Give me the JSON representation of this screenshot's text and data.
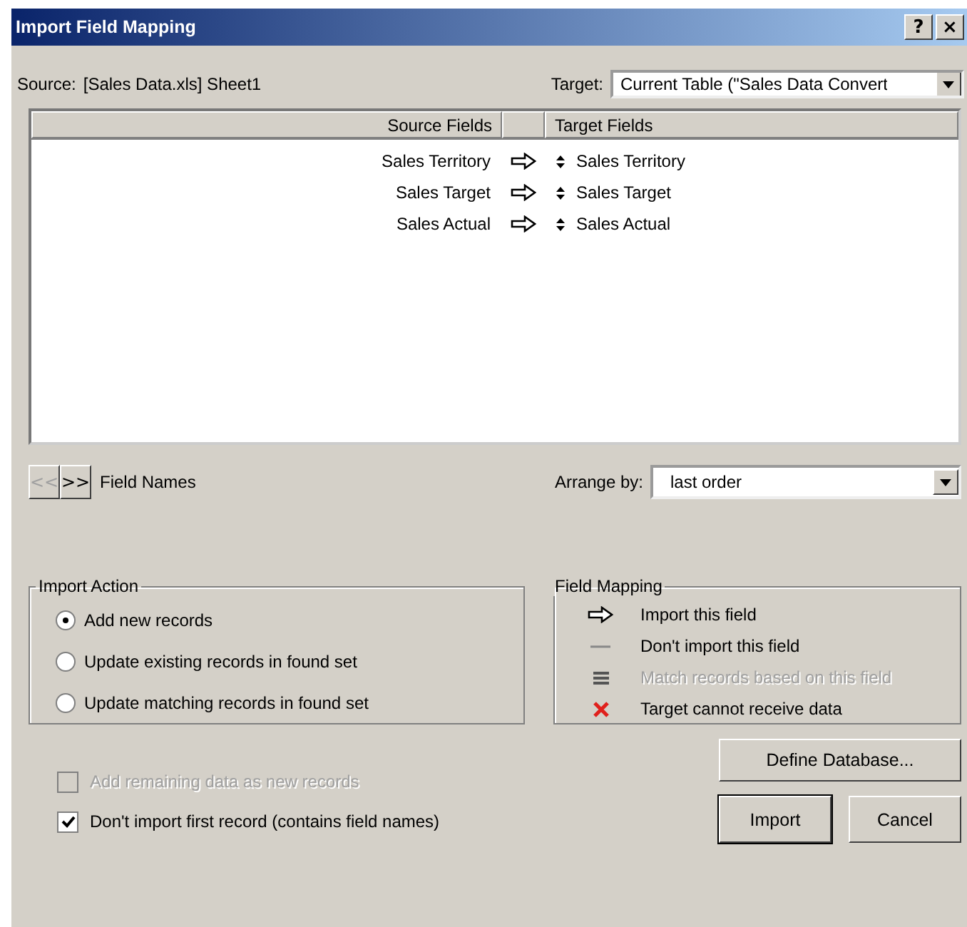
{
  "window": {
    "title": "Import Field Mapping",
    "title_buttons": [
      "?",
      "×"
    ]
  },
  "source": {
    "label": "Source:",
    "value": "[Sales Data.xls] Sheet1"
  },
  "target": {
    "label": "Target:",
    "value": "Current Table (\"Sales Data Convert"
  },
  "table": {
    "columns": [
      "Source Fields",
      "Target Fields"
    ],
    "rows": [
      {
        "source": "Sales Territory",
        "target": "Sales Territory"
      },
      {
        "source": "Sales Target",
        "target": "Sales Target"
      },
      {
        "source": "Sales Actual",
        "target": "Sales Actual"
      }
    ]
  },
  "field_names": {
    "prev": "<<",
    "next": ">>",
    "prev_disabled": true,
    "label": "Field Names"
  },
  "arrange_by": {
    "label": "Arrange by:",
    "value": "last order"
  },
  "import_action": {
    "title": "Import Action",
    "options": [
      {
        "label": "Add new records",
        "selected": true
      },
      {
        "label": "Update existing records in found set",
        "selected": false
      },
      {
        "label": "Update matching records in found set",
        "selected": false
      }
    ]
  },
  "field_mapping": {
    "title": "Field Mapping",
    "items": [
      {
        "kind": "import",
        "label": "Import this field",
        "disabled": false
      },
      {
        "kind": "skip",
        "label": "Don't import this field",
        "disabled": false
      },
      {
        "kind": "match",
        "label": "Match records based on this field",
        "disabled": true
      },
      {
        "kind": "error",
        "label": "Target cannot receive data",
        "disabled": false
      }
    ]
  },
  "checkboxes": [
    {
      "label": "Add remaining data as new records",
      "checked": false,
      "disabled": true
    },
    {
      "label": "Don't import first record (contains field names)",
      "checked": true,
      "disabled": false
    }
  ],
  "buttons": {
    "define": "Define Database...",
    "import": "Import",
    "cancel": "Cancel"
  }
}
